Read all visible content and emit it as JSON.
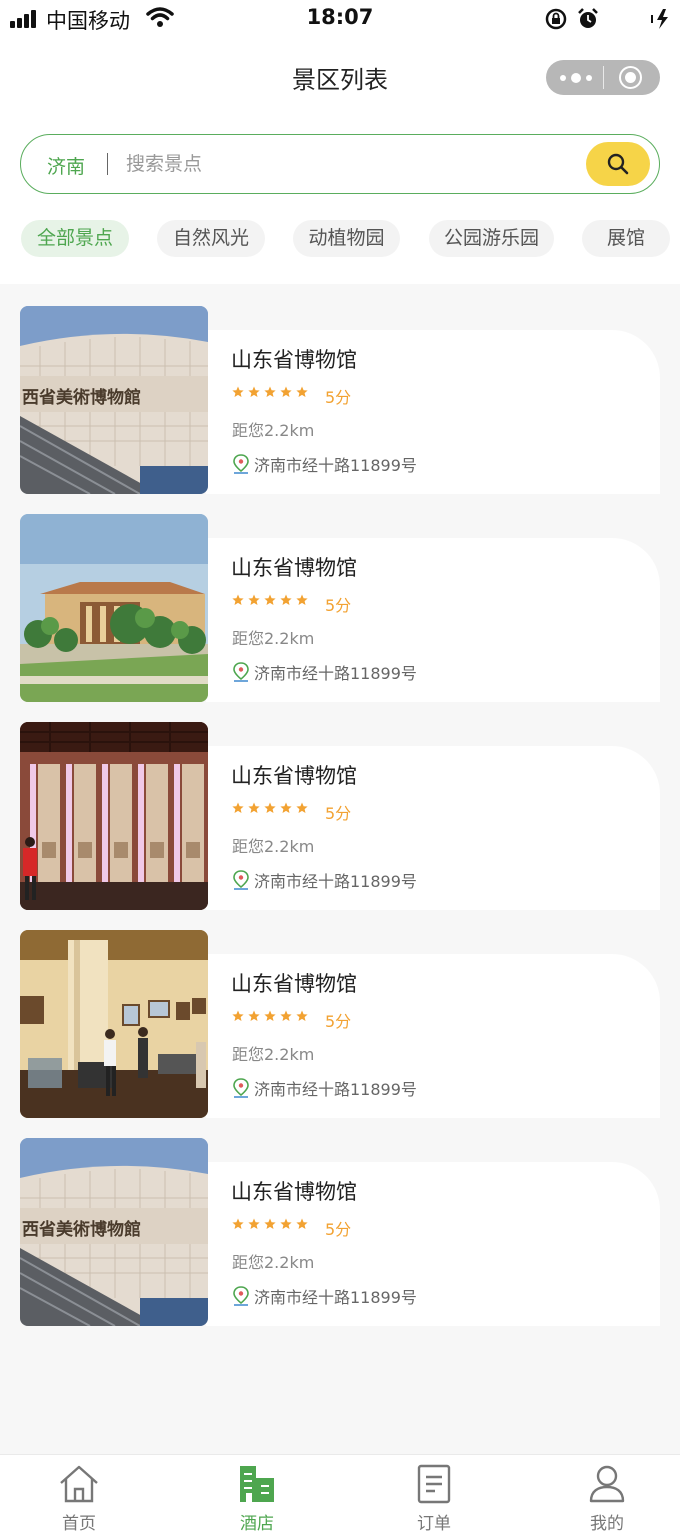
{
  "status_bar": {
    "carrier": "中国移动",
    "time": "18:07"
  },
  "header": {
    "title": "景区列表"
  },
  "search": {
    "city": "济南",
    "placeholder": "搜索景点",
    "value": ""
  },
  "categories": [
    {
      "label": "全部景点",
      "active": true
    },
    {
      "label": "自然风光",
      "active": false
    },
    {
      "label": "动植物园",
      "active": false
    },
    {
      "label": "公园游乐园",
      "active": false
    },
    {
      "label": "展馆",
      "active": false
    }
  ],
  "spots": [
    {
      "name": "山东省博物馆",
      "rating": 5,
      "score": "5分",
      "distance": "距您2.2km",
      "address": "济南市经十路11899号",
      "image": "museum-facade"
    },
    {
      "name": "山东省博物馆",
      "rating": 5,
      "score": "5分",
      "distance": "距您2.2km",
      "address": "济南市经十路11899号",
      "image": "museum-garden"
    },
    {
      "name": "山东省博物馆",
      "rating": 5,
      "score": "5分",
      "distance": "距您2.2km",
      "address": "济南市经十路11899号",
      "image": "carved-screens"
    },
    {
      "name": "山东省博物馆",
      "rating": 5,
      "score": "5分",
      "distance": "距您2.2km",
      "address": "济南市经十路11899号",
      "image": "exhibition-hall"
    },
    {
      "name": "山东省博物馆",
      "rating": 5,
      "score": "5分",
      "distance": "距您2.2km",
      "address": "济南市经十路11899号",
      "image": "museum-facade"
    }
  ],
  "tabbar": [
    {
      "label": "首页",
      "icon": "home-icon",
      "active": false
    },
    {
      "label": "酒店",
      "icon": "hotel-icon",
      "active": true
    },
    {
      "label": "订单",
      "icon": "order-icon",
      "active": false
    },
    {
      "label": "我的",
      "icon": "user-icon",
      "active": false
    }
  ],
  "colors": {
    "accent": "#4ea64f",
    "search_button": "#f6d448",
    "star": "#f2a232"
  }
}
